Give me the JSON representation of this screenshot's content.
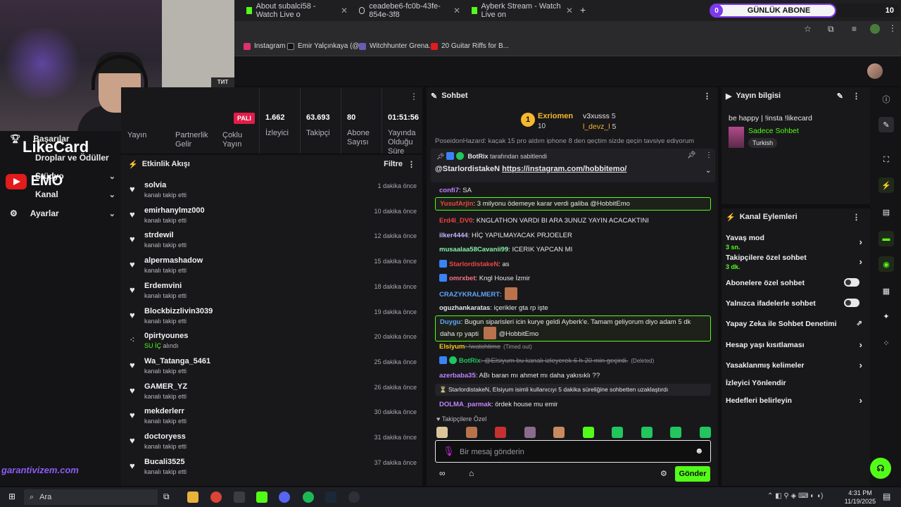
{
  "browser": {
    "tabs": [
      {
        "title": "About subalci58 - Watch Live o",
        "color": "#53fc18"
      },
      {
        "title": "ceadebe6-fc0b-43fe-854e-3f8",
        "color": "#e8e8ea"
      },
      {
        "title": "Ayberk Stream - Watch Live on",
        "color": "#53fc18"
      }
    ],
    "bookmarks": [
      {
        "label": "Instagram",
        "color": "#e1306c"
      },
      {
        "label": "Emir Yalçınkaya (@...",
        "color": "#111111"
      },
      {
        "label": "Witchhunter Grena...",
        "color": "#6b5bb3"
      },
      {
        "label": "20 Guitar Riffs for B...",
        "color": "#e21b1b"
      }
    ]
  },
  "overlay": {
    "abone_count": "0",
    "abone_label": "GÜNLÜK ABONE",
    "abone_goal": "10",
    "likecard": "LikeCard",
    "emo": "EMO",
    "garanti": "garantivizem.com",
    "cam_sign": "ТИТ"
  },
  "leftnav": {
    "items": [
      {
        "label": "Başarılar",
        "icon": "trophy-icon"
      },
      {
        "label": "Droplar ve Ödüller",
        "icon": "gift-icon"
      },
      {
        "label": "Stüdyo",
        "icon": "studio-icon",
        "chevron": true
      },
      {
        "label": "Kanal",
        "icon": "channel-icon",
        "chevron": true
      },
      {
        "label": "Ayarlar",
        "icon": "gear-icon",
        "chevron": true
      }
    ]
  },
  "stats": {
    "badge": "PALI",
    "top_labels": [
      "Yayın",
      "Partnerlik Gelir",
      "Çoklu Yayın"
    ],
    "items": [
      {
        "value": "1.662",
        "label": "İzleyici"
      },
      {
        "value": "63.693",
        "label": "Takipçi"
      },
      {
        "value": "80",
        "label": "Abone Sayısı"
      },
      {
        "value": "01:51:56",
        "label": "Yayında Olduğu Süre"
      }
    ]
  },
  "feed": {
    "title": "Etkinlik Akışı",
    "filter": "Filtre",
    "rows": [
      {
        "name": "solvia",
        "sub": "kanalı takip etti",
        "time": "1 dakika önce",
        "icon": "heart"
      },
      {
        "name": "emirhanylmz000",
        "sub": "kanalı takip etti",
        "time": "10 dakika önce",
        "icon": "heart"
      },
      {
        "name": "strdewil",
        "sub": "kanalı takip etti",
        "time": "12 dakika önce",
        "icon": "heart"
      },
      {
        "name": "alpermashadow",
        "sub": "kanalı takip etti",
        "time": "15 dakika önce",
        "icon": "heart"
      },
      {
        "name": "Erdemvini",
        "sub": "kanalı takip etti",
        "time": "18 dakika önce",
        "icon": "heart"
      },
      {
        "name": "Blockbizzlivin3039",
        "sub": "kanalı takip etti",
        "time": "19 dakika önce",
        "icon": "heart"
      },
      {
        "name": "0pirtyounes",
        "sub_hl": "SU İÇ",
        "sub": " alındı",
        "time": "20 dakika önce",
        "icon": "reward"
      },
      {
        "name": "Wa_Tatanga_5461",
        "sub": "kanalı takip etti",
        "time": "25 dakika önce",
        "icon": "heart"
      },
      {
        "name": "GAMER_YZ",
        "sub": "kanalı takip etti",
        "time": "26 dakika önce",
        "icon": "heart"
      },
      {
        "name": "mekderlerr",
        "sub": "kanalı takip etti",
        "time": "30 dakika önce",
        "icon": "heart"
      },
      {
        "name": "doctoryess",
        "sub": "kanalı takip etti",
        "time": "31 dakika önce",
        "icon": "heart"
      },
      {
        "name": "Bucali3525",
        "sub": "kanalı takip etti",
        "time": "37 dakika önce",
        "icon": "heart"
      }
    ]
  },
  "chat": {
    "title": "Sohbet",
    "leaderboard": {
      "first_name": "Exriomen",
      "first_count": "10",
      "rank": "1",
      "others": [
        {
          "name": "v3xusss",
          "count": "5"
        },
        {
          "name": "l_devz_l",
          "count": "5"
        }
      ]
    },
    "scrolled_line": "PoseidonHazard: kaçak 15 pro aldım iphone 8 den geçtim sizde geçin tavsiye ediyorum",
    "pinned": {
      "by": "BotRix",
      "by_suffix": " tarafından sabitlendi",
      "author": "@StarlordistakeN",
      "link": "https://instagram.com/hobbitemo/"
    },
    "messages": [
      {
        "user": "confi7",
        "color": "#c084fc",
        "text": ": SA"
      },
      {
        "user": "YusufArjin",
        "color": "#ef4444",
        "text": ": 3 milyonu ödemeye karar verdi galiba @HobbitEmo",
        "highlight": true
      },
      {
        "user": "Erd4l_DV0",
        "color": "#ef4444",
        "text": ": KNGLATHON VARDI BI ARA 3UNUZ YAYIN ACACAKTINI"
      },
      {
        "user": "ilker4444",
        "color": "#c4b5fd",
        "text": ": HİÇ YAPILMAYACAK PRJOELER"
      },
      {
        "user": "musaalaa58Cavanii99",
        "color": "#86efac",
        "text": ": ICERIK YAPCAN MI"
      },
      {
        "user": "StarlordistakeN",
        "color": "#ef4444",
        "text": ": as",
        "prime": true
      },
      {
        "user": "omrxbet",
        "color": "#fb7185",
        "text": ": Kngl House İzmir",
        "prime": true
      },
      {
        "user": "CRAZYKRALMERT",
        "color": "#60a5fa",
        "text": ":",
        "emote": true
      },
      {
        "user": "oguzhankaratas",
        "color": "#e5e7eb",
        "text": ": içerikler gta rp işte"
      },
      {
        "user": "Duygu",
        "color": "#60a5fa",
        "text": ": Bugun siparisleri icin kurye geldi Ayberk'e. Tamam geliyorum diyo adam 5 dk daha rp yapti",
        "text2": "@HobbitEmo",
        "highlight": true
      },
      {
        "user": "Elsiyum",
        "color": "#facc15",
        "text": ": !watchtime",
        "note": "(Timed out)",
        "struck": true
      },
      {
        "user": "BotRix",
        "color": "#22c55e",
        "text": ": @Elsiyum bu kanalı izleyerek 6 h 20 min geçirdi.",
        "note": "(Deleted)",
        "struck": true,
        "bot": true
      },
      {
        "user": "azerbaba35",
        "color": "#c084fc",
        "text": ": ABı baran mı ahmet mı daha yakısıklı ??"
      },
      {
        "system": true,
        "text": "StarlordistakeN, Elsiyum isimli kullanıcıyı 5 dakika süreliğine sohbetten uzaklaştırdı"
      },
      {
        "user": "DOLMA_parmak",
        "color": "#c084fc",
        "text": ": ördek house mu emir"
      }
    ],
    "emote_section": "Takipçilere Özel",
    "placeholder": "Bir mesaj gönderin",
    "send": "Gönder"
  },
  "info": {
    "title": "Yayın bilgisi",
    "stream_title": "be happy | !insta !likecard",
    "category": "Sadece Sohbet",
    "tag": "Turkish"
  },
  "actions": {
    "title": "Kanal Eylemleri",
    "items": [
      {
        "label": "Yavaş mod",
        "sub": "3 sn.",
        "control": "chevron"
      },
      {
        "label": "Takipçilere özel sohbet",
        "sub": "3 dk.",
        "control": "chevron"
      },
      {
        "label": "Abonelere özel sohbet",
        "control": "toggle"
      },
      {
        "label": "Yalnızca ifadelerle sohbet",
        "control": "toggle"
      },
      {
        "label": "Yapay Zeka ile Sohbet Denetimi",
        "control": "external"
      },
      {
        "label": "Hesap yaşı kısıtlaması",
        "control": "chevron"
      },
      {
        "label": "Yasaklanmış kelimeler",
        "control": "chevron"
      },
      {
        "label": "İzleyici Yönlendir",
        "control": "none"
      },
      {
        "label": "Hedefleri belirleyin",
        "control": "chevron"
      }
    ]
  },
  "taskbar": {
    "search": "Ara",
    "time": "4:31 PM",
    "date": "11/19/2025"
  }
}
